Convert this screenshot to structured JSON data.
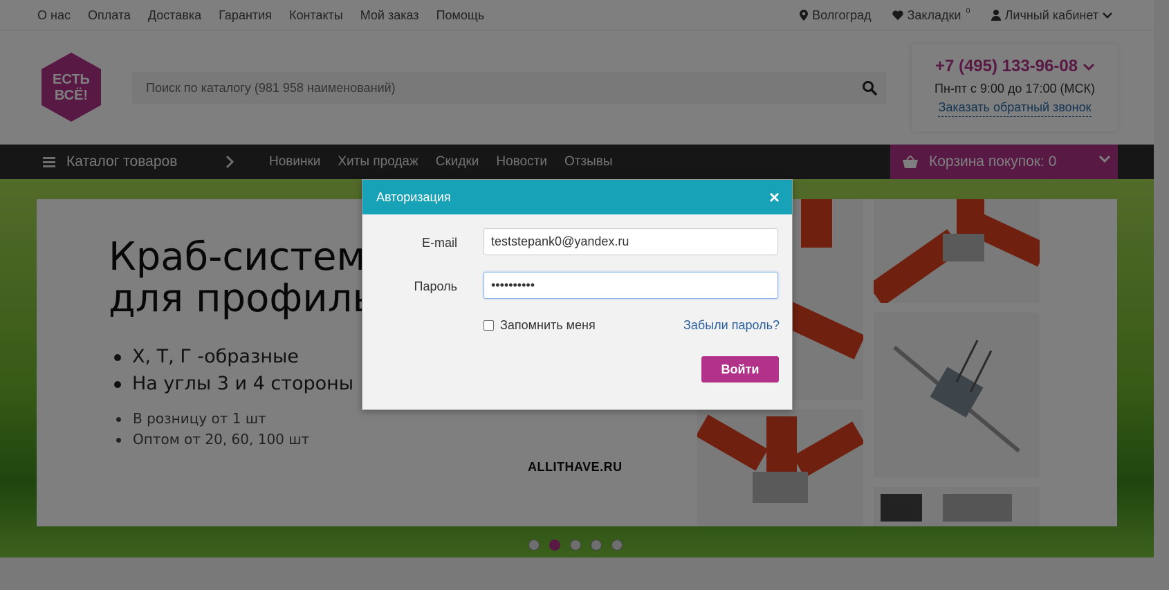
{
  "topnav": {
    "links": [
      "О нас",
      "Оплата",
      "Доставка",
      "Гарантия",
      "Контакты",
      "Мой заказ",
      "Помощь"
    ],
    "city": "Волгоград",
    "bookmarks": "Закладки",
    "bookmarks_count": "0",
    "account": "Личный кабинет"
  },
  "header": {
    "logo_text_1": "ЕСТЬ",
    "logo_text_2": "ВСЁ!",
    "search_placeholder": "Поиск по каталогу (981 958 наименований)",
    "phone": "+7 (495) 133-96-08",
    "hours": "Пн-пт с 9:00 до 17:00 (МСК)",
    "callback": "Заказать обратный звонок"
  },
  "mainnav": {
    "catalog": "Каталог товаров",
    "links": [
      "Новинки",
      "Хиты продаж",
      "Скидки",
      "Новости",
      "Отзывы"
    ],
    "cart": "Корзина покупок: 0"
  },
  "banner": {
    "title_line1": "Краб-систем",
    "title_line2": "для профиль",
    "list1": [
      "Х, Т, Г -образные",
      "На углы 3 и 4 стороны"
    ],
    "list2": [
      "В розницу от 1 шт",
      "Оптом от 20, 60, 100 шт"
    ],
    "site": "ALLITHAVE.RU",
    "active_slide": 2,
    "slide_count": 5
  },
  "modal": {
    "title": "Авторизация",
    "close": "×",
    "email_label": "E-mail",
    "email_value": "teststepank0@yandex.ru",
    "password_label": "Пароль",
    "password_value": "••••••••••",
    "remember": "Запомнить меня",
    "forgot": "Забыли пароль?",
    "submit": "Войти"
  },
  "colors": {
    "brand": "#b2328a",
    "modal_header": "#17a2b8",
    "nav_bg": "#2d2d2d"
  }
}
